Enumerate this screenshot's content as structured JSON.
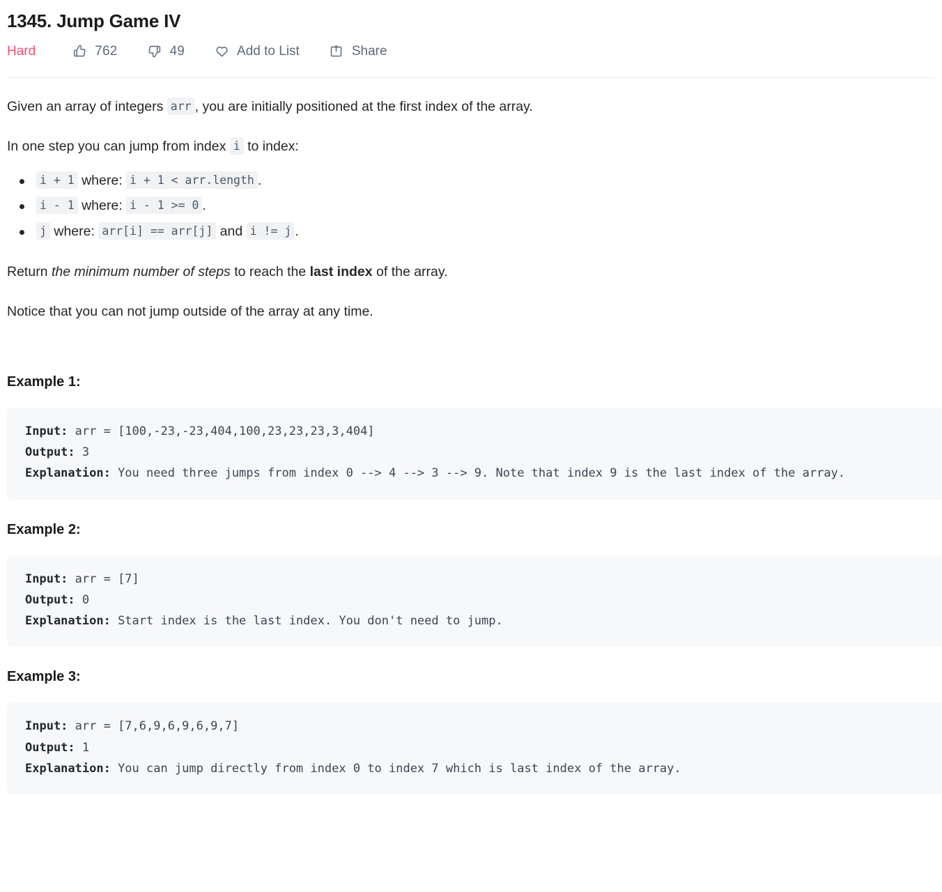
{
  "problem": {
    "title": "1345. Jump Game IV",
    "difficulty": "Hard",
    "difficulty_color": "#ef4f72"
  },
  "actions": {
    "likes": "762",
    "dislikes": "49",
    "add_to_list": "Add to List",
    "share": "Share"
  },
  "description": {
    "p1_a": "Given an array of integers ",
    "p1_code": "arr",
    "p1_b": ", you are initially positioned at the first index of the array.",
    "p2_a": "In one step you can jump from index ",
    "p2_code": "i",
    "p2_b": " to index:",
    "rules": [
      {
        "code1": "i + 1",
        "mid": " where: ",
        "code2": "i + 1 < arr.length",
        "tail": "."
      },
      {
        "code1": "i - 1",
        "mid": " where: ",
        "code2": "i - 1 >= 0",
        "tail": "."
      },
      {
        "code1": "j",
        "mid": " where: ",
        "code2": "arr[i] == arr[j]",
        "mid2": " and ",
        "code3": "i != j",
        "tail": "."
      }
    ],
    "p3_a": "Return ",
    "p3_italic": "the minimum number of steps",
    "p3_b": " to reach the ",
    "p3_bold": "last index",
    "p3_c": " of the array.",
    "p4": "Notice that you can not jump outside of the array at any time."
  },
  "examples": [
    {
      "heading": "Example 1:",
      "input_label": "Input:",
      "input_value": " arr = [100,-23,-23,404,100,23,23,23,3,404]",
      "output_label": "Output:",
      "output_value": " 3",
      "explanation_label": "Explanation:",
      "explanation_value": " You need three jumps from index 0 --> 4 --> 3 --> 9. Note that index 9 is the last index of the array."
    },
    {
      "heading": "Example 2:",
      "input_label": "Input:",
      "input_value": " arr = [7]",
      "output_label": "Output:",
      "output_value": " 0",
      "explanation_label": "Explanation:",
      "explanation_value": " Start index is the last index. You don't need to jump."
    },
    {
      "heading": "Example 3:",
      "input_label": "Input:",
      "input_value": " arr = [7,6,9,6,9,6,9,7]",
      "output_label": "Output:",
      "output_value": " 1",
      "explanation_label": "Explanation:",
      "explanation_value": " You can jump directly from index 0 to index 7 which is last index of the array."
    }
  ]
}
